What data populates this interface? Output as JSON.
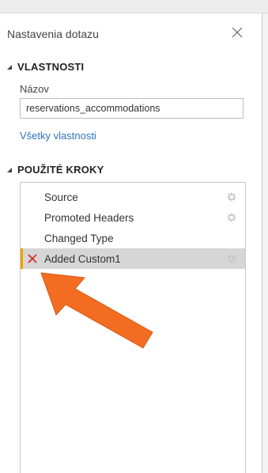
{
  "panel": {
    "title": "Nastavenia dotazu"
  },
  "properties": {
    "header": "VLASTNOSTI",
    "name_label": "Názov",
    "name_value": "reservations_accommodations",
    "all_properties_link": "Všetky vlastnosti"
  },
  "applied_steps": {
    "header": "POUŽITÉ KROKY",
    "steps": [
      {
        "label": "Source",
        "has_settings": true,
        "error": false,
        "selected": false
      },
      {
        "label": "Promoted Headers",
        "has_settings": true,
        "error": false,
        "selected": false
      },
      {
        "label": "Changed Type",
        "has_settings": false,
        "error": false,
        "selected": false
      },
      {
        "label": "Added Custom1",
        "has_settings": true,
        "error": true,
        "selected": true
      }
    ]
  },
  "colors": {
    "link": "#2b73c2",
    "error": "#e02020",
    "selected_bg": "#d6d6d6",
    "selected_marker": "#e8a400",
    "annotation_arrow": "#f26d21"
  },
  "icons": {
    "close": "close-icon",
    "collapse": "collapse-triangle-icon",
    "gear": "gear-icon",
    "error": "error-x-icon"
  }
}
